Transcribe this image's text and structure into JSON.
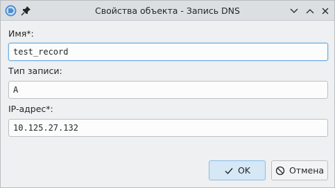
{
  "window": {
    "title": "Свойства объекта - Запись DNS"
  },
  "form": {
    "name_label": "Имя*:",
    "name_value": "test_record",
    "type_label": "Тип записи:",
    "type_value": "A",
    "ip_label": "IP-адрес*:",
    "ip_value": "10.125.27.132"
  },
  "buttons": {
    "ok_label": "OK",
    "cancel_label": "Отмена"
  },
  "icons": {
    "app": "app-logo-icon",
    "pin": "pin-icon",
    "minimize": "chevron-down-icon",
    "maximize": "chevron-up-icon",
    "close": "close-icon",
    "ok": "checkmark-icon",
    "cancel": "cancel-icon"
  }
}
